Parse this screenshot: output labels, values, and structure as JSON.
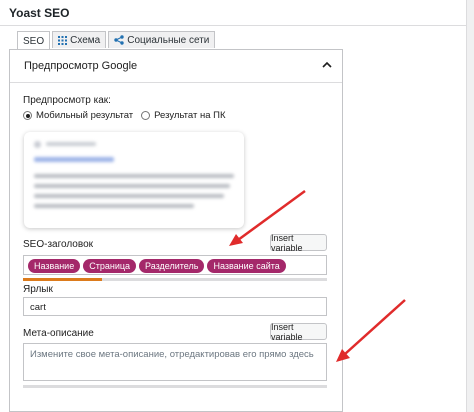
{
  "panel": {
    "title": "Yoast SEO"
  },
  "tabs": [
    {
      "label": "SEO",
      "icon": "none"
    },
    {
      "label": "Схема",
      "icon": "grid-icon"
    },
    {
      "label": "Социальные сети",
      "icon": "share-icon"
    }
  ],
  "section": {
    "title": "Предпросмотр Google"
  },
  "preview": {
    "label": "Предпросмотр как:",
    "options": [
      "Мобильный результат",
      "Результат на ПК"
    ],
    "selected": "Мобильный результат"
  },
  "seo_title": {
    "label": "SEO-заголовок",
    "insert_label": "Insert variable",
    "chips": [
      "Название",
      "Страница",
      "Разделитель",
      "Название сайта"
    ],
    "progress_fraction": 0.26
  },
  "slug": {
    "label": "Ярлык",
    "value": "cart"
  },
  "meta": {
    "label": "Мета-описание",
    "insert_label": "Insert variable",
    "placeholder": "Измените свое мета-описание, отредактировав его прямо здесь",
    "progress_fraction": 0
  },
  "colors": {
    "chip": "#a4286a",
    "progress_orange": "#dc7b1c",
    "arrow": "#e02b2b"
  }
}
